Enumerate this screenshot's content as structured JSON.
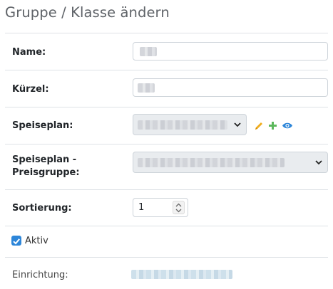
{
  "page": {
    "title": "Gruppe / Klasse ändern"
  },
  "form": {
    "name": {
      "label": "Name:",
      "value": ""
    },
    "kuerzel": {
      "label": "Kürzel:",
      "value": ""
    },
    "speiseplan": {
      "label": "Speiseplan:",
      "value": ""
    },
    "preisgruppe": {
      "label_line1": "Speiseplan -",
      "label_line2": "Preisgruppe:",
      "value": ""
    },
    "sortierung": {
      "label": "Sortierung:",
      "value": "1"
    },
    "aktiv": {
      "label": "Aktiv",
      "checked": true
    },
    "einrichtung": {
      "label": "Einrichtung:",
      "value": ""
    }
  },
  "icons": {
    "edit": "pencil-icon",
    "add": "plus-icon",
    "view": "eye-icon",
    "colors": {
      "edit": "#f0ad1e",
      "add": "#5cb85c",
      "view": "#2d86d9",
      "checkbox": "#2d86d9"
    }
  }
}
